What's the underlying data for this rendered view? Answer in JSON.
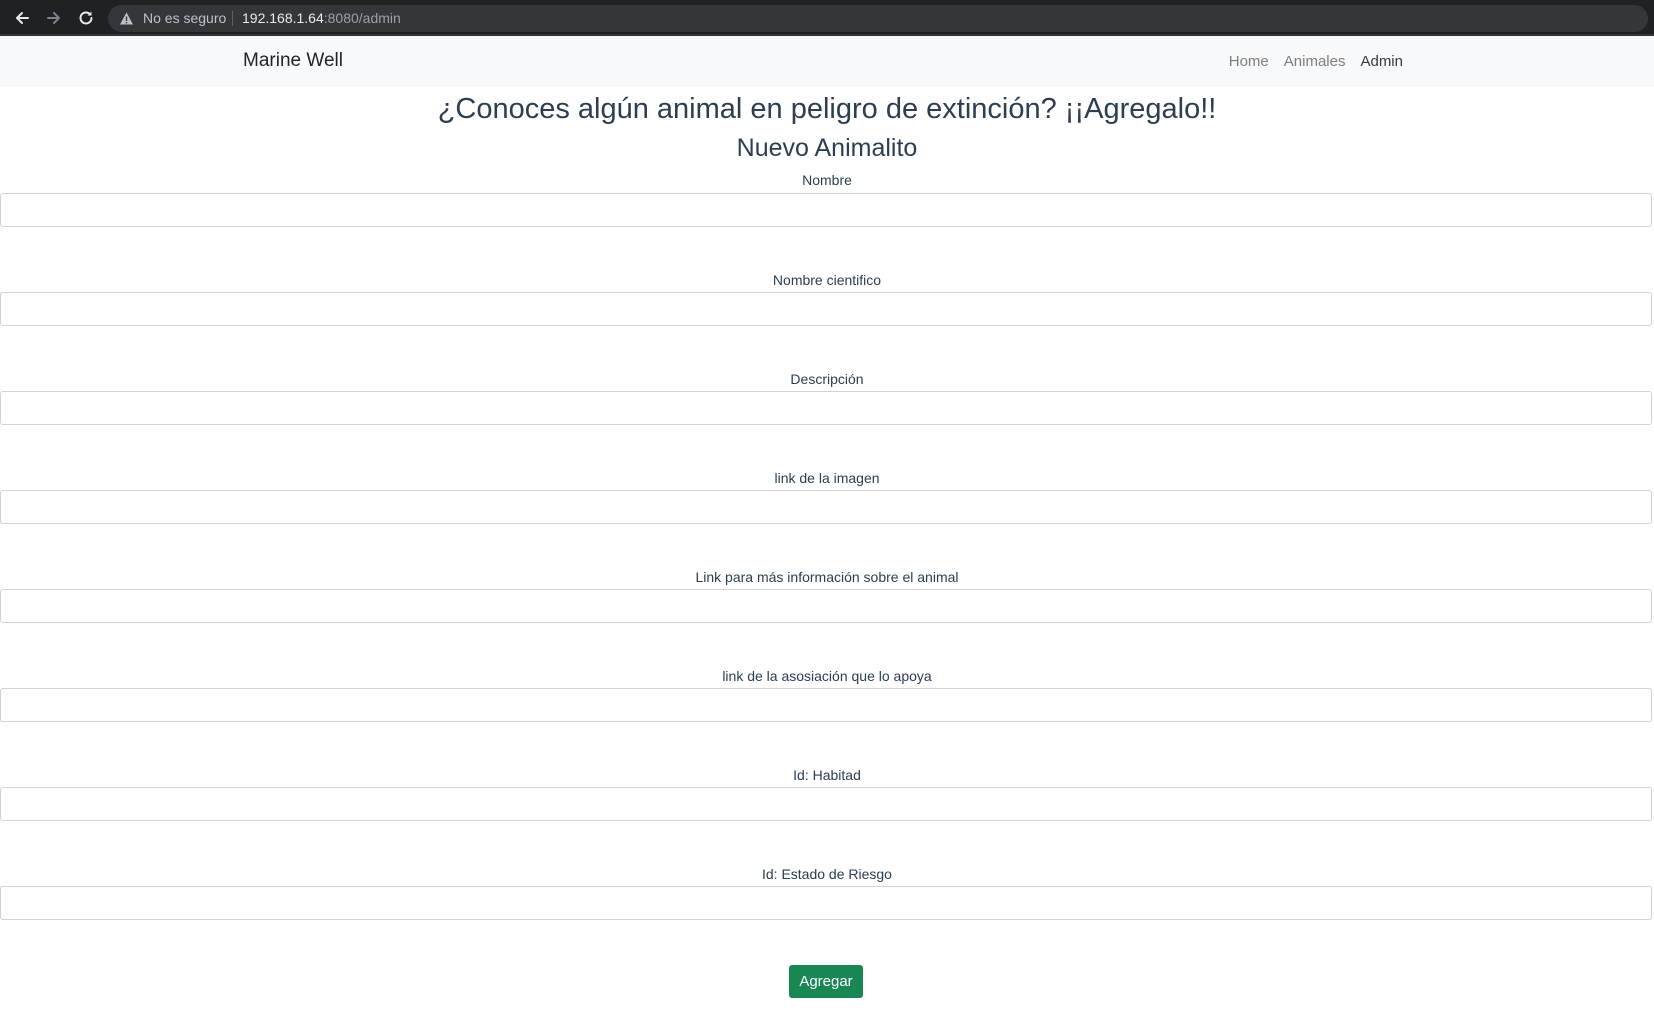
{
  "browser": {
    "security_label": "No es seguro",
    "url_host": "192.168.1.64",
    "url_rest": ":8080/admin"
  },
  "navbar": {
    "brand": "Marine Well",
    "links": [
      {
        "label": "Home",
        "active": false
      },
      {
        "label": "Animales",
        "active": false
      },
      {
        "label": "Admin",
        "active": true
      }
    ]
  },
  "page": {
    "hero_title": "¿Conoces algún animal en peligro de extinción? ¡¡Agregalo!!",
    "form_title": "Nuevo Animalito"
  },
  "form": {
    "fields": [
      {
        "label": "Nombre",
        "value": ""
      },
      {
        "label": "Nombre cientifico",
        "value": ""
      },
      {
        "label": "Descripción",
        "value": ""
      },
      {
        "label": "link de la imagen",
        "value": ""
      },
      {
        "label": "Link para más información sobre el animal",
        "value": ""
      },
      {
        "label": "link de la asosiación que lo apoya",
        "value": ""
      },
      {
        "label": "Id: Habitad",
        "value": ""
      },
      {
        "label": "Id: Estado de Riesgo",
        "value": ""
      }
    ],
    "submit_label": "Agregar"
  },
  "colors": {
    "accent_green": "#198754",
    "heading": "#2c3e50",
    "navbar_bg": "#f8f9fa"
  }
}
